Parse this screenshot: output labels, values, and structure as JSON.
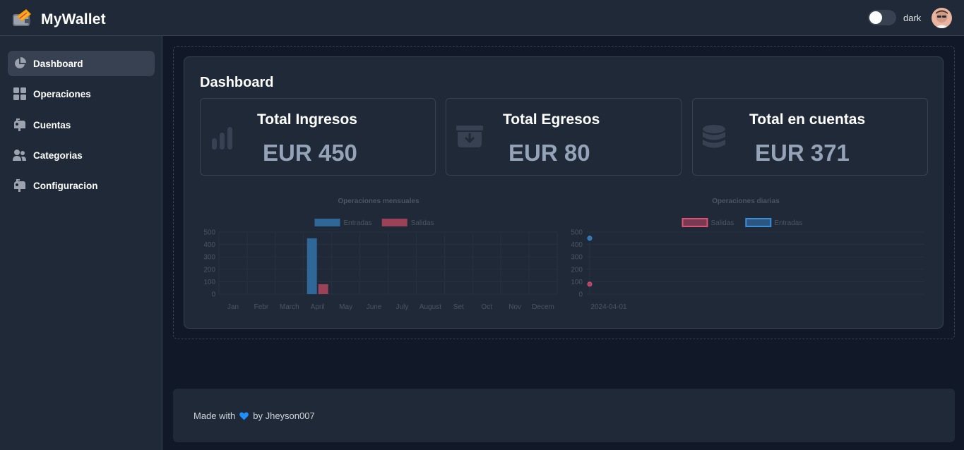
{
  "app": {
    "title": "MyWallet"
  },
  "header": {
    "theme_label": "dark"
  },
  "sidebar": {
    "items": [
      {
        "label": "Dashboard",
        "icon": "pie-chart-icon",
        "active": true
      },
      {
        "label": "Operaciones",
        "icon": "grid-icon"
      },
      {
        "label": "Cuentas",
        "icon": "mailbox-icon"
      },
      {
        "label": "Categorias",
        "icon": "users-icon"
      },
      {
        "label": "Configuracion",
        "icon": "mailbox-icon"
      }
    ]
  },
  "main": {
    "title": "Dashboard",
    "stats": [
      {
        "title": "Total Ingresos",
        "value": "EUR 450",
        "icon": "bar-chart-icon"
      },
      {
        "title": "Total Egresos",
        "value": "EUR 80",
        "icon": "archive-icon"
      },
      {
        "title": "Total en cuentas",
        "value": "EUR 371",
        "icon": "database-icon"
      }
    ]
  },
  "chart_data": [
    {
      "type": "bar",
      "title": "Operaciones mensuales",
      "categories": [
        "Jan",
        "Febr",
        "March",
        "April",
        "May",
        "June",
        "July",
        "August",
        "Set",
        "Oct",
        "Nov",
        "Decem"
      ],
      "series": [
        {
          "name": "Entradas",
          "values": [
            0,
            0,
            0,
            450,
            0,
            0,
            0,
            0,
            0,
            0,
            0,
            0
          ],
          "color": "#2f6799"
        },
        {
          "name": "Salidas",
          "values": [
            0,
            0,
            0,
            80,
            0,
            0,
            0,
            0,
            0,
            0,
            0,
            0
          ],
          "color": "#9b4258"
        }
      ],
      "yticks": [
        "0",
        "100",
        "200",
        "300",
        "400",
        "500"
      ],
      "ylim": [
        0,
        500
      ],
      "legend": "top",
      "grid": true
    },
    {
      "type": "line",
      "title": "Operaciones diarias",
      "x": [
        "2024-04-01"
      ],
      "series": [
        {
          "name": "Salidas",
          "values": [
            80
          ],
          "color": "#e05275"
        },
        {
          "name": "Entradas",
          "values": [
            450
          ],
          "color": "#3b8fd9"
        }
      ],
      "yticks": [
        "0",
        "100",
        "200",
        "300",
        "400",
        "500"
      ],
      "ylim": [
        0,
        500
      ],
      "legend": "top",
      "grid": true
    }
  ],
  "footer": {
    "prefix": "Made with",
    "suffix": "by Jheyson007",
    "icon": "heart-icon"
  },
  "colors": {
    "background": "#111827",
    "surface": "#1f2937",
    "border": "#374151",
    "accent": "#3b82f6"
  }
}
